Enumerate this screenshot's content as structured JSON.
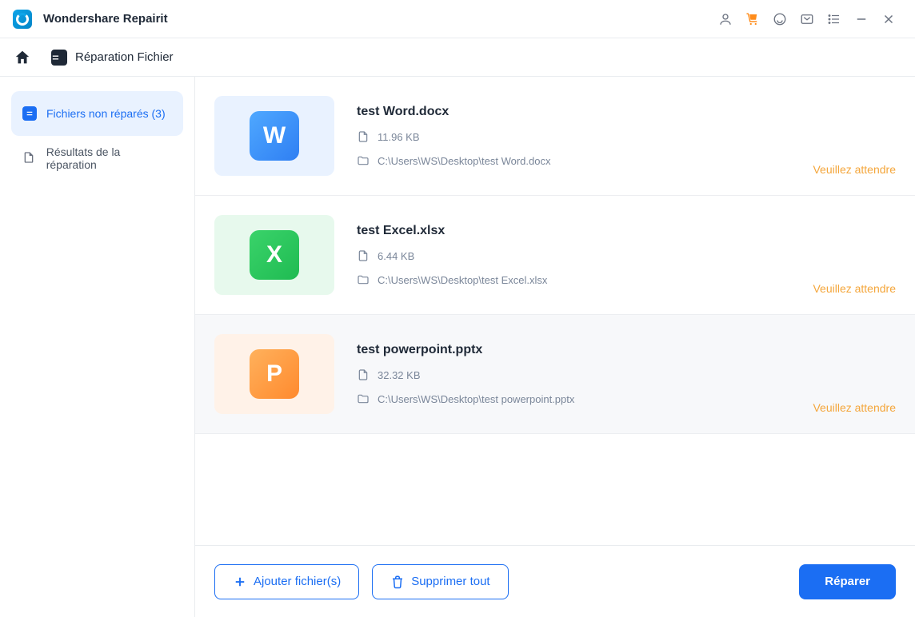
{
  "app": {
    "title": "Wondershare Repairit"
  },
  "nav": {
    "section_label": "Réparation Fichier"
  },
  "sidebar": {
    "items": [
      {
        "label": "Fichiers non réparés (3)"
      },
      {
        "label": "Résultats de la réparation"
      }
    ]
  },
  "files": [
    {
      "name": "test Word.docx",
      "size": "11.96  KB",
      "path": "C:\\Users\\WS\\Desktop\\test Word.docx",
      "status": "Veuillez attendre",
      "glyph": "W"
    },
    {
      "name": "test Excel.xlsx",
      "size": "6.44  KB",
      "path": "C:\\Users\\WS\\Desktop\\test Excel.xlsx",
      "status": "Veuillez attendre",
      "glyph": "X"
    },
    {
      "name": "test powerpoint.pptx",
      "size": "32.32  KB",
      "path": "C:\\Users\\WS\\Desktop\\test powerpoint.pptx",
      "status": "Veuillez attendre",
      "glyph": "P"
    }
  ],
  "footer": {
    "add_label": "Ajouter fichier(s)",
    "delete_label": "Supprimer tout",
    "repair_label": "Réparer"
  }
}
